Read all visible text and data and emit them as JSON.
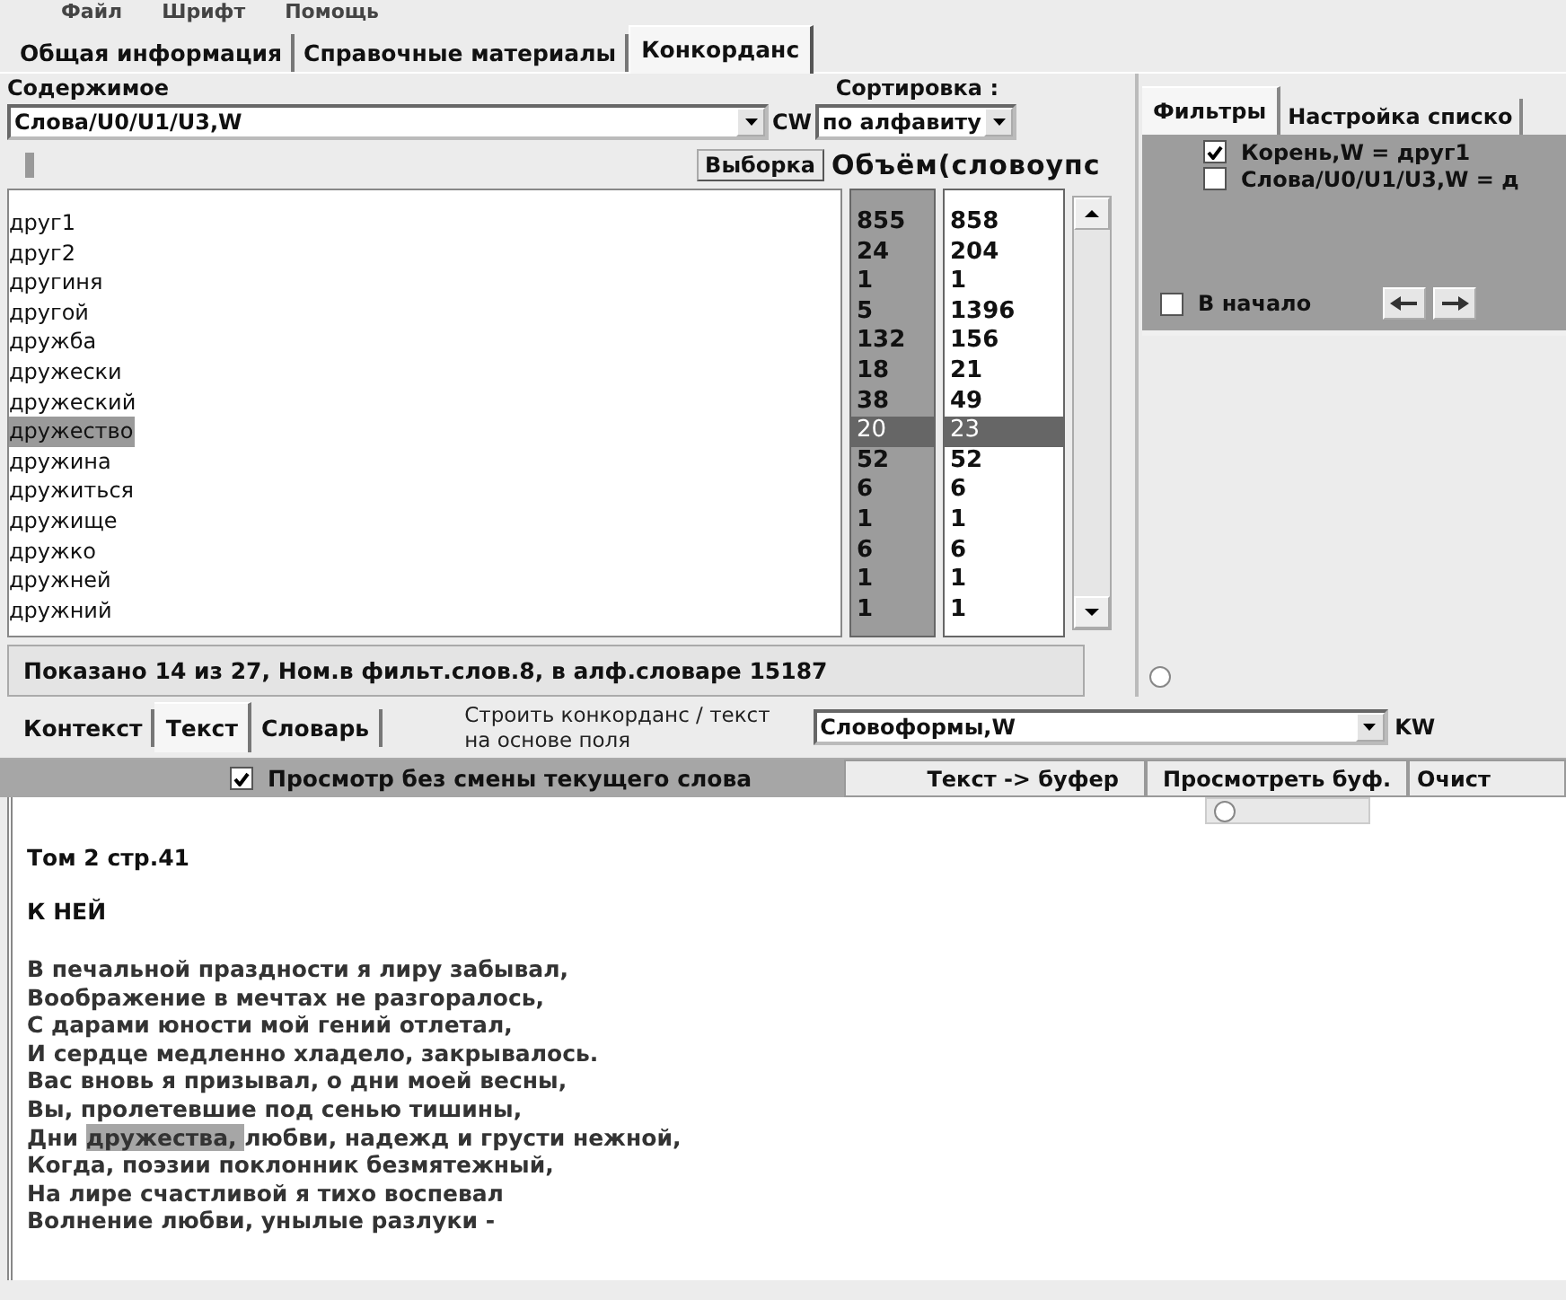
{
  "menu": [
    {
      "label": "Файл"
    },
    {
      "label": "Шрифт"
    },
    {
      "label": "Помощь"
    }
  ],
  "main_tabs": [
    {
      "label": "Общая информация",
      "selected": false
    },
    {
      "label": "Справочные материалы",
      "selected": false
    },
    {
      "label": "Конкорданс",
      "selected": true
    }
  ],
  "contents": {
    "label": "Содержимое",
    "value": "Слова/U0/U1/U3,W",
    "suffix": "CW"
  },
  "sorting": {
    "label": "Сортировка :",
    "value": "по алфавиту"
  },
  "sample_button": "Выборка",
  "volume_header": "Объём(словоупс",
  "words": [
    {
      "word": "друг1",
      "count_1": "855",
      "count_2": "858",
      "selected": false
    },
    {
      "word": "друг2",
      "count_1": "24",
      "count_2": "204",
      "selected": false
    },
    {
      "word": "другиня",
      "count_1": "1",
      "count_2": "1",
      "selected": false
    },
    {
      "word": "другой",
      "count_1": "5",
      "count_2": "1396",
      "selected": false
    },
    {
      "word": "дружба",
      "count_1": "132",
      "count_2": "156",
      "selected": false
    },
    {
      "word": "дружески",
      "count_1": "18",
      "count_2": "21",
      "selected": false
    },
    {
      "word": "дружеский",
      "count_1": "38",
      "count_2": "49",
      "selected": false
    },
    {
      "word": "дружество",
      "count_1": "20",
      "count_2": "23",
      "selected": true
    },
    {
      "word": "дружина",
      "count_1": "52",
      "count_2": "52",
      "selected": false
    },
    {
      "word": "дружиться",
      "count_1": "6",
      "count_2": "6",
      "selected": false
    },
    {
      "word": "дружище",
      "count_1": "1",
      "count_2": "1",
      "selected": false
    },
    {
      "word": "дружко",
      "count_1": "6",
      "count_2": "6",
      "selected": false
    },
    {
      "word": "дружней",
      "count_1": "1",
      "count_2": "1",
      "selected": false
    },
    {
      "word": "дружний",
      "count_1": "1",
      "count_2": "1",
      "selected": false
    }
  ],
  "status": "Показано 14 из 27,  Ном.в фильт.слов.8, в алф.словаре 15187",
  "filters": {
    "tabs": [
      {
        "label": "Фильтры",
        "selected": true
      },
      {
        "label": "Настройка списко",
        "selected": false
      }
    ],
    "items": [
      {
        "label": "Корень,W = друг1",
        "checked": true
      },
      {
        "label": "Слова/U0/U1/U3,W = д",
        "checked": false
      }
    ],
    "to_start": {
      "label": "В начало",
      "checked": false
    }
  },
  "radio_buttons": [
    {
      "selected": false
    },
    {
      "selected": false
    }
  ],
  "bottom_tabs": [
    {
      "label": "Контекст",
      "selected": false
    },
    {
      "label": "Текст",
      "selected": true
    },
    {
      "label": "Словарь",
      "selected": false
    }
  ],
  "build_label": "Строить конкорданс / текст на основе поля",
  "field": {
    "value": "Словоформы,W",
    "suffix": "KW"
  },
  "preview": {
    "label": "Просмотр без смены текущего слова",
    "checked": true
  },
  "buttons": [
    "Текст -> буфер",
    "Просмотреть буф.",
    "Очист"
  ],
  "text": {
    "header": "Том 2 стр.41",
    "title": "К НЕЙ",
    "lines": [
      {
        "segments": [
          {
            "text": "В печальной праздности я лиру забывал,",
            "highlighted": false
          }
        ]
      },
      {
        "segments": [
          {
            "text": "Воображение в мечтах не разгоралось,",
            "highlighted": false
          }
        ]
      },
      {
        "segments": [
          {
            "text": "С дарами юности мой гений отлетал,",
            "highlighted": false
          }
        ]
      },
      {
        "segments": [
          {
            "text": "И сердце медленно хладело, закрывалось.",
            "highlighted": false
          }
        ]
      },
      {
        "segments": [
          {
            "text": "Вас вновь я призывал, о дни моей весны,",
            "highlighted": false
          }
        ]
      },
      {
        "segments": [
          {
            "text": "Вы, пролетевшие под сенью тишины,",
            "highlighted": false
          }
        ]
      },
      {
        "segments": [
          {
            "text": "Дни ",
            "highlighted": false
          },
          {
            "text": "дружества, ",
            "highlighted": true
          },
          {
            "text": "любви, надежд и грусти нежной,",
            "highlighted": false
          }
        ]
      },
      {
        "segments": [
          {
            "text": "Когда, поэзии поклонник безмятежный,",
            "highlighted": false
          }
        ]
      },
      {
        "segments": [
          {
            "text": "На лире счастливой я тихо воспевал",
            "highlighted": false
          }
        ]
      },
      {
        "segments": [
          {
            "text": "Волнение любви, унылые разлуки -",
            "highlighted": false
          }
        ]
      }
    ]
  }
}
